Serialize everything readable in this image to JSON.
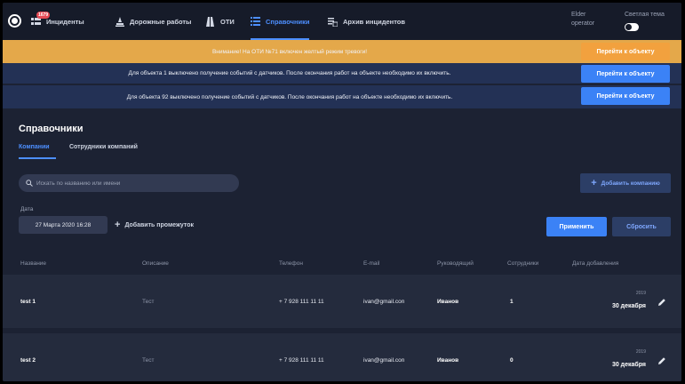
{
  "nav": {
    "badge": "1679",
    "items": [
      {
        "label": "Инциденты",
        "icon": "incidents-icon"
      },
      {
        "label": "Дорожные работы",
        "icon": "road-works-icon"
      },
      {
        "label": "ОТИ",
        "icon": "oti-icon"
      },
      {
        "label": "Справочники",
        "icon": "directory-icon",
        "active": true
      },
      {
        "label": "Архив инцидентов",
        "icon": "archive-icon"
      }
    ],
    "user_name": "Elder",
    "user_role": "operator",
    "theme_label": "Светлая тема"
  },
  "banners": [
    {
      "text": "Внимание! На ОТИ №71 включен желтый режим тревоги!",
      "button": "Перейти к объекту",
      "color": "#e4a84a"
    },
    {
      "text": "Для объекта 1 выключено получение событий с датчиков. После окончания работ на объекте необходимо их включить.",
      "button": "Перейти к объекту",
      "color": "#233155"
    },
    {
      "text": "Для объекта 92 выключено получение событий с датчиков. После окончания работ на объекте необходимо их включить.",
      "button": "Перейти к объекту",
      "color": "#233155"
    }
  ],
  "page": {
    "title": "Справочники",
    "tabs": [
      "Компании",
      "Сотрудники компаний"
    ],
    "search_placeholder": "Искать по названию или имени",
    "add_company": "Добавить компанию",
    "date_label": "Дата",
    "date_value": "27 Марта 2020 16:28",
    "add_range": "Добавить промежуток",
    "apply": "Применить",
    "reset": "Сбросить"
  },
  "table": {
    "headers": [
      "Название",
      "Описание",
      "Телефон",
      "E-mail",
      "Руководящий",
      "Сотрудники",
      "Дата добавления"
    ],
    "rows": [
      {
        "name": "test 1",
        "description": "Тест",
        "phone": "+ 7 928 111 11 11",
        "email": "ivan@gmail.con",
        "manager": "Иванов",
        "employees": "1",
        "year": "2019",
        "day": "30 декабря"
      },
      {
        "name": "test 2",
        "description": "Тест",
        "phone": "+ 7 928 111 11 11",
        "email": "ivan@gmail.con",
        "manager": "Иванов",
        "employees": "0",
        "year": "2019",
        "day": "30 декабря"
      }
    ]
  },
  "colors": {
    "accent": "#3b82f6",
    "warning": "#e4a84a",
    "background": "#1c2233"
  }
}
